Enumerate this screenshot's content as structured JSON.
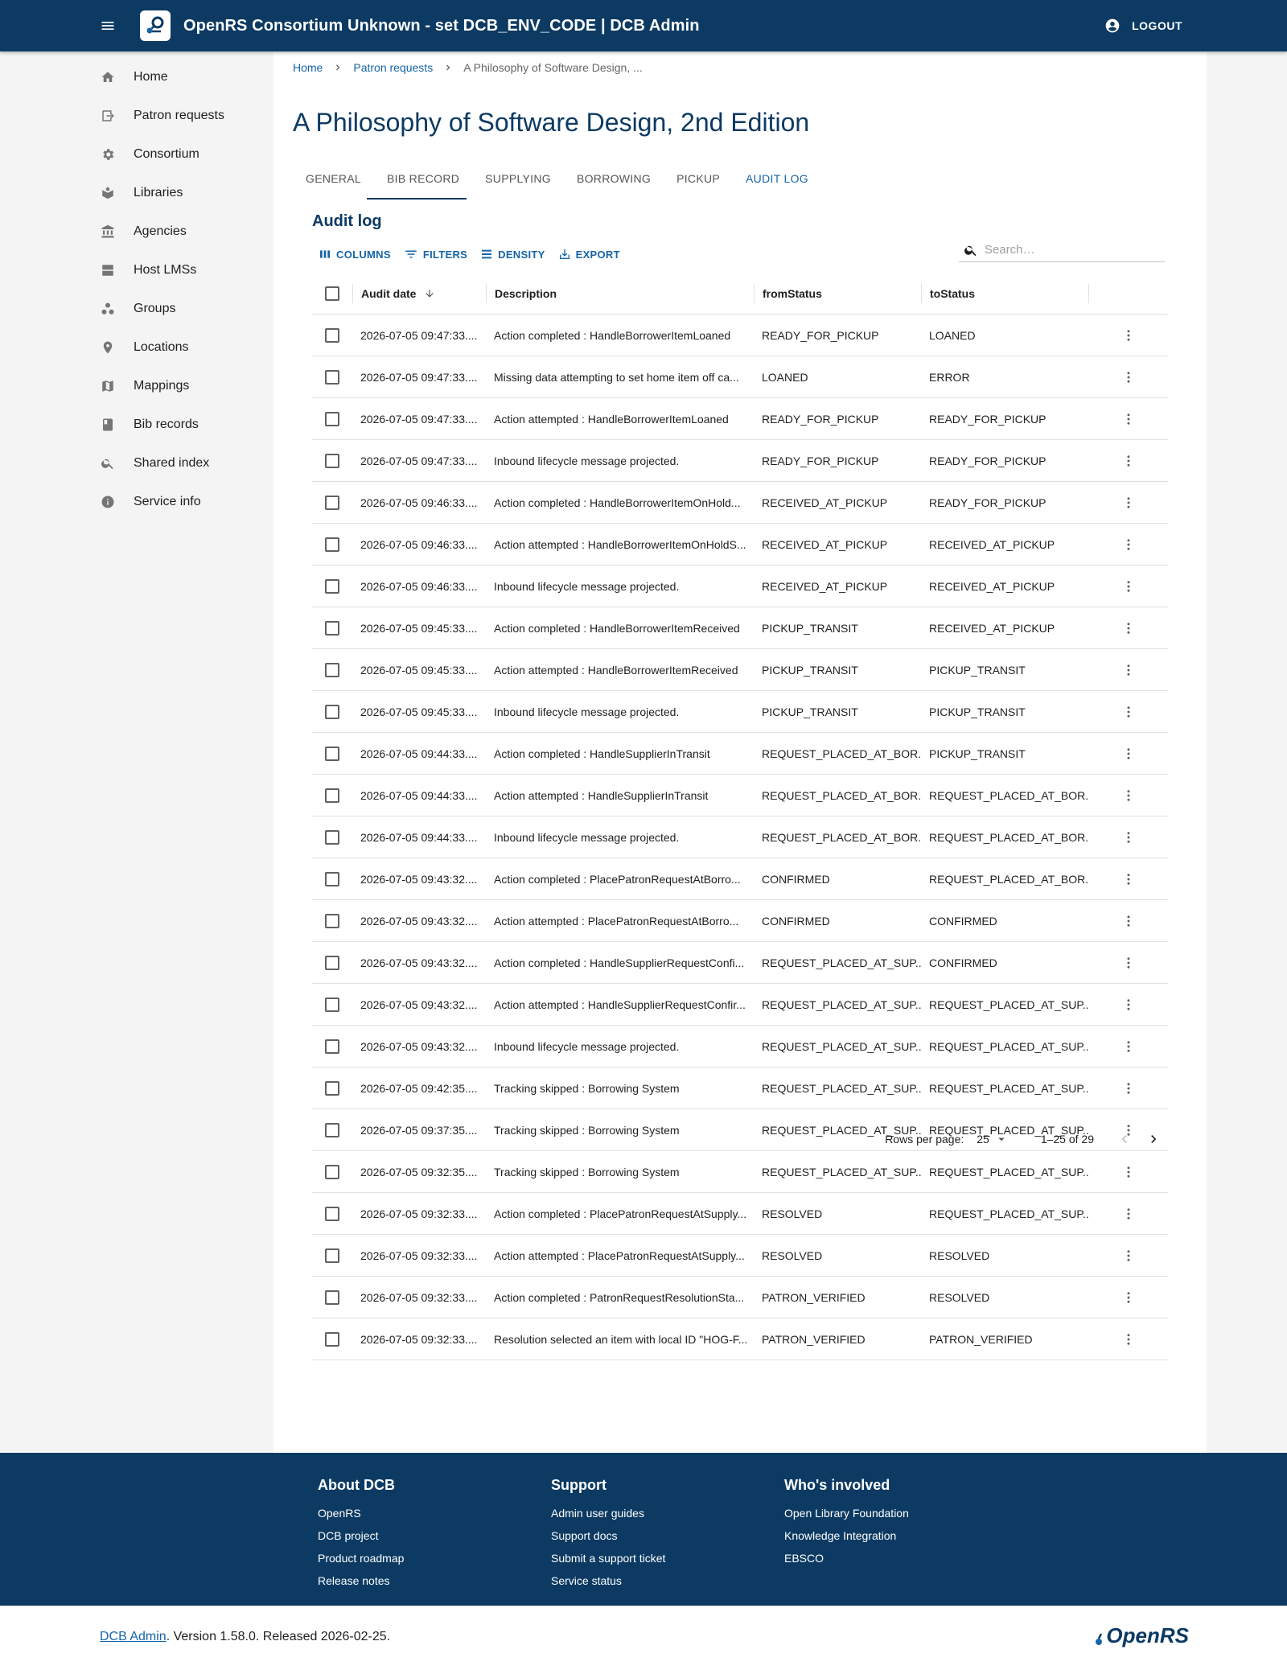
{
  "appbar": {
    "title": "OpenRS Consortium Unknown - set DCB_ENV_CODE | DCB Admin",
    "logout_label": "LOGOUT"
  },
  "sidebar": {
    "items": [
      {
        "label": "Home",
        "icon": "home-icon"
      },
      {
        "label": "Patron requests",
        "icon": "patron-requests-icon"
      },
      {
        "label": "Consortium",
        "icon": "gear-icon"
      },
      {
        "label": "Libraries",
        "icon": "libraries-icon"
      },
      {
        "label": "Agencies",
        "icon": "bank-icon"
      },
      {
        "label": "Host LMSs",
        "icon": "server-icon"
      },
      {
        "label": "Groups",
        "icon": "groups-icon"
      },
      {
        "label": "Locations",
        "icon": "location-pin-icon"
      },
      {
        "label": "Mappings",
        "icon": "map-icon"
      },
      {
        "label": "Bib records",
        "icon": "book-icon"
      },
      {
        "label": "Shared index",
        "icon": "search-icon"
      },
      {
        "label": "Service info",
        "icon": "info-icon"
      }
    ]
  },
  "breadcrumb": {
    "home": "Home",
    "patron_requests": "Patron requests",
    "current": "A Philosophy of Software Design, ..."
  },
  "page_title": "A Philosophy of Software Design, 2nd Edition",
  "tabs": [
    "GENERAL",
    "BIB RECORD",
    "SUPPLYING",
    "BORROWING",
    "PICKUP",
    "AUDIT LOG"
  ],
  "active_tab": "AUDIT LOG",
  "section_title": "Audit log",
  "toolbar": {
    "columns": "COLUMNS",
    "filters": "FILTERS",
    "density": "DENSITY",
    "export": "EXPORT"
  },
  "search": {
    "placeholder": "Search…",
    "value": ""
  },
  "grid": {
    "headers": {
      "date": "Audit date",
      "desc": "Description",
      "from": "fromStatus",
      "to": "toStatus"
    },
    "rows": [
      {
        "date": "2026-07-05 09:47:33....",
        "desc": "Action completed : HandleBorrowerItemLoaned",
        "from": "READY_FOR_PICKUP",
        "to": "LOANED"
      },
      {
        "date": "2026-07-05 09:47:33....",
        "desc": "Missing data attempting to set home item off ca...",
        "from": "LOANED",
        "to": "ERROR"
      },
      {
        "date": "2026-07-05 09:47:33....",
        "desc": "Action attempted : HandleBorrowerItemLoaned",
        "from": "READY_FOR_PICKUP",
        "to": "READY_FOR_PICKUP"
      },
      {
        "date": "2026-07-05 09:47:33....",
        "desc": "Inbound lifecycle message projected.",
        "from": "READY_FOR_PICKUP",
        "to": "READY_FOR_PICKUP"
      },
      {
        "date": "2026-07-05 09:46:33....",
        "desc": "Action completed : HandleBorrowerItemOnHold...",
        "from": "RECEIVED_AT_PICKUP",
        "to": "READY_FOR_PICKUP"
      },
      {
        "date": "2026-07-05 09:46:33....",
        "desc": "Action attempted : HandleBorrowerItemOnHoldS...",
        "from": "RECEIVED_AT_PICKUP",
        "to": "RECEIVED_AT_PICKUP"
      },
      {
        "date": "2026-07-05 09:46:33....",
        "desc": "Inbound lifecycle message projected.",
        "from": "RECEIVED_AT_PICKUP",
        "to": "RECEIVED_AT_PICKUP"
      },
      {
        "date": "2026-07-05 09:45:33....",
        "desc": "Action completed : HandleBorrowerItemReceived",
        "from": "PICKUP_TRANSIT",
        "to": "RECEIVED_AT_PICKUP"
      },
      {
        "date": "2026-07-05 09:45:33....",
        "desc": "Action attempted : HandleBorrowerItemReceived",
        "from": "PICKUP_TRANSIT",
        "to": "PICKUP_TRANSIT"
      },
      {
        "date": "2026-07-05 09:45:33....",
        "desc": "Inbound lifecycle message projected.",
        "from": "PICKUP_TRANSIT",
        "to": "PICKUP_TRANSIT"
      },
      {
        "date": "2026-07-05 09:44:33....",
        "desc": "Action completed : HandleSupplierInTransit",
        "from": "REQUEST_PLACED_AT_BOR...",
        "to": "PICKUP_TRANSIT"
      },
      {
        "date": "2026-07-05 09:44:33....",
        "desc": "Action attempted : HandleSupplierInTransit",
        "from": "REQUEST_PLACED_AT_BOR...",
        "to": "REQUEST_PLACED_AT_BOR..."
      },
      {
        "date": "2026-07-05 09:44:33....",
        "desc": "Inbound lifecycle message projected.",
        "from": "REQUEST_PLACED_AT_BOR...",
        "to": "REQUEST_PLACED_AT_BOR..."
      },
      {
        "date": "2026-07-05 09:43:32....",
        "desc": "Action completed : PlacePatronRequestAtBorro...",
        "from": "CONFIRMED",
        "to": "REQUEST_PLACED_AT_BOR..."
      },
      {
        "date": "2026-07-05 09:43:32....",
        "desc": "Action attempted : PlacePatronRequestAtBorro...",
        "from": "CONFIRMED",
        "to": "CONFIRMED"
      },
      {
        "date": "2026-07-05 09:43:32....",
        "desc": "Action completed : HandleSupplierRequestConfi...",
        "from": "REQUEST_PLACED_AT_SUP...",
        "to": "CONFIRMED"
      },
      {
        "date": "2026-07-05 09:43:32....",
        "desc": "Action attempted : HandleSupplierRequestConfir...",
        "from": "REQUEST_PLACED_AT_SUP...",
        "to": "REQUEST_PLACED_AT_SUP..."
      },
      {
        "date": "2026-07-05 09:43:32....",
        "desc": "Inbound lifecycle message projected.",
        "from": "REQUEST_PLACED_AT_SUP...",
        "to": "REQUEST_PLACED_AT_SUP..."
      },
      {
        "date": "2026-07-05 09:42:35....",
        "desc": "Tracking skipped : Borrowing System",
        "from": "REQUEST_PLACED_AT_SUP...",
        "to": "REQUEST_PLACED_AT_SUP..."
      },
      {
        "date": "2026-07-05 09:37:35....",
        "desc": "Tracking skipped : Borrowing System",
        "from": "REQUEST_PLACED_AT_SUP...",
        "to": "REQUEST_PLACED_AT_SUP..."
      },
      {
        "date": "2026-07-05 09:32:35....",
        "desc": "Tracking skipped : Borrowing System",
        "from": "REQUEST_PLACED_AT_SUP...",
        "to": "REQUEST_PLACED_AT_SUP..."
      },
      {
        "date": "2026-07-05 09:32:33....",
        "desc": "Action completed : PlacePatronRequestAtSupply...",
        "from": "RESOLVED",
        "to": "REQUEST_PLACED_AT_SUP..."
      },
      {
        "date": "2026-07-05 09:32:33....",
        "desc": "Action attempted : PlacePatronRequestAtSupply...",
        "from": "RESOLVED",
        "to": "RESOLVED"
      },
      {
        "date": "2026-07-05 09:32:33....",
        "desc": "Action completed : PatronRequestResolutionSta...",
        "from": "PATRON_VERIFIED",
        "to": "RESOLVED"
      },
      {
        "date": "2026-07-05 09:32:33....",
        "desc": "Resolution selected an item with local ID \"HOG-F...",
        "from": "PATRON_VERIFIED",
        "to": "PATRON_VERIFIED"
      }
    ]
  },
  "pagination": {
    "rows_per_page_label": "Rows per page:",
    "rows_per_page": "25",
    "range": "1–25 of 29"
  },
  "footer": {
    "about": {
      "title": "About DCB",
      "links": [
        "OpenRS",
        "DCB project",
        "Product roadmap",
        "Release notes"
      ]
    },
    "support": {
      "title": "Support",
      "links": [
        "Admin user guides",
        "Support docs",
        "Submit a support ticket",
        "Service status"
      ]
    },
    "involved": {
      "title": "Who's involved",
      "links": [
        "Open Library Foundation",
        "Knowledge Integration",
        "EBSCO"
      ]
    }
  },
  "bottom": {
    "app_link": "DCB Admin",
    "version_text": ". Version 1.58.0. Released 2026-02-25.",
    "brand": "OpenRS"
  },
  "colors": {
    "primary": "#0c3a63",
    "link": "#1565a8",
    "footer_bg": "#0c3a63"
  }
}
